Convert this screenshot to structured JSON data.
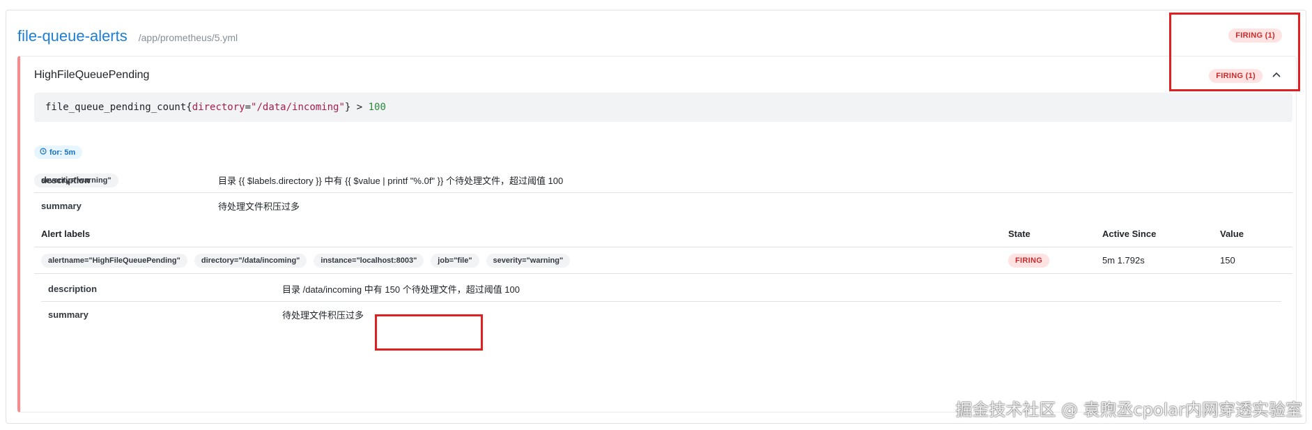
{
  "group": {
    "name": "file-queue-alerts",
    "file": "/app/prometheus/5.yml",
    "badge": "FIRING (1)"
  },
  "rule": {
    "name": "HighFileQueuePending",
    "badge": "FIRING (1)",
    "chevron_icon": "chevron-up-icon",
    "expr": {
      "metric": "file_queue_pending_count",
      "label_key": "directory",
      "label_value": "\"/data/incoming\"",
      "op": " > ",
      "threshold": "100"
    },
    "for": "for: 5m",
    "labels": [
      "severity=\"warning\""
    ],
    "annotations": [
      {
        "key": "description",
        "value": "目录 {{ $labels.directory }} 中有 {{ $value | printf \"%.0f\" }} 个待处理文件，超过阈值 100"
      },
      {
        "key": "summary",
        "value": "待处理文件积压过多"
      }
    ]
  },
  "alerts_table": {
    "headers": {
      "labels": "Alert labels",
      "state": "State",
      "active_since": "Active Since",
      "value": "Value"
    },
    "rows": [
      {
        "labels": [
          "alertname=\"HighFileQueuePending\"",
          "directory=\"/data/incoming\"",
          "instance=\"localhost:8003\"",
          "job=\"file\"",
          "severity=\"warning\""
        ],
        "state": "FIRING",
        "active_since": "5m 1.792s",
        "value": "150"
      }
    ]
  },
  "alert_annotations": [
    {
      "key": "description",
      "value": "目录 /data/incoming 中有 150 个待处理文件，超过阈值 100"
    },
    {
      "key": "summary",
      "value": "待处理文件积压过多"
    }
  ],
  "watermark": "掘金技术社区 @ 袁煦丞cpolar内网穿透实验室",
  "colors": {
    "firing_bg": "#ffe3e3",
    "firing_text": "#c92a2a",
    "accent": "#1c7ed6",
    "rule_border": "#ff8787",
    "highlight": "#e02020"
  }
}
